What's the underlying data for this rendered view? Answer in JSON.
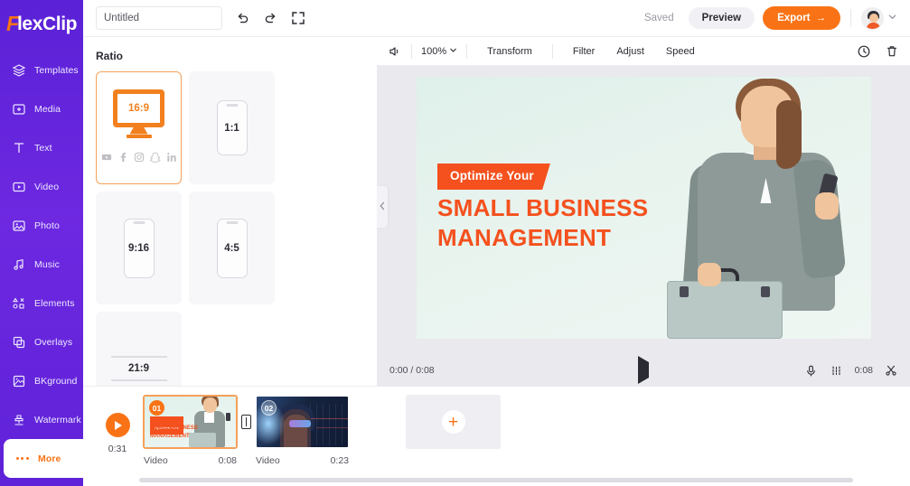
{
  "app": {
    "logo_f": "F",
    "logo_rest": "lexClip"
  },
  "sidebar": {
    "items": [
      {
        "label": "Templates",
        "icon": "templates-icon"
      },
      {
        "label": "Media",
        "icon": "media-icon"
      },
      {
        "label": "Text",
        "icon": "text-icon"
      },
      {
        "label": "Video",
        "icon": "video-icon"
      },
      {
        "label": "Photo",
        "icon": "photo-icon"
      },
      {
        "label": "Music",
        "icon": "music-icon"
      },
      {
        "label": "Elements",
        "icon": "elements-icon"
      },
      {
        "label": "Overlays",
        "icon": "overlays-icon"
      },
      {
        "label": "BKground",
        "icon": "background-icon"
      },
      {
        "label": "Watermark",
        "icon": "watermark-icon"
      },
      {
        "label": "More",
        "icon": "more-dots-icon"
      }
    ],
    "active_label": "More",
    "accent": "#f97316",
    "background": "#5f22d8"
  },
  "topbar": {
    "project_title": "Untitled",
    "project_title_placeholder": "Untitled",
    "undo_icon": "undo-icon",
    "redo_icon": "redo-icon",
    "fullscreen_icon": "fullscreen-icon",
    "saved_label": "Saved",
    "preview_label": "Preview",
    "export_label": "Export",
    "export_arrow": "→",
    "avatar": "user-avatar",
    "chevron": "chevron-down-icon"
  },
  "ratio_panel": {
    "title": "Ratio",
    "options": [
      {
        "label": "16:9",
        "shape": "monitor",
        "selected": true,
        "socials": [
          "youtube-icon",
          "facebook-icon",
          "instagram-icon",
          "snapchat-icon",
          "linkedin-icon"
        ]
      },
      {
        "label": "1:1",
        "shape": "phone",
        "selected": false
      },
      {
        "label": "9:16",
        "shape": "phone-tall",
        "selected": false
      },
      {
        "label": "4:5",
        "shape": "phone",
        "selected": false
      },
      {
        "label": "21:9",
        "shape": "wide",
        "selected": false
      }
    ],
    "collapse_icon": "chevron-left-icon"
  },
  "editor_toolbar": {
    "volume_icon": "volume-icon",
    "zoom_value": "100%",
    "zoom_chevron": "chevron-down-icon",
    "items": [
      "Transform",
      "Filter",
      "Adjust",
      "Speed"
    ],
    "history_icon": "clock-icon",
    "delete_icon": "trash-icon"
  },
  "preview": {
    "ribbon_text": "Optimize Your",
    "headline_line1": "SMALL BUSINESS",
    "headline_line2": "MANAGEMENT",
    "accent_color": "#f4511e",
    "background_color": "#e4f1ec"
  },
  "playback": {
    "time_display": "0:00 / 0:08",
    "play_icon": "play-icon",
    "mic_icon": "microphone-icon",
    "split_icon": "split-icon",
    "clip_duration": "0:08",
    "scissors_icon": "scissors-icon"
  },
  "timeline": {
    "play_icon": "play-icon",
    "total_duration": "0:31",
    "split_handle_icon": "split-handle-icon",
    "add_icon": "plus-icon",
    "clips": [
      {
        "number": "01",
        "type": "Video",
        "duration": "0:08",
        "selected": true
      },
      {
        "number": "02",
        "type": "Video",
        "duration": "0:23",
        "selected": false
      }
    ]
  }
}
